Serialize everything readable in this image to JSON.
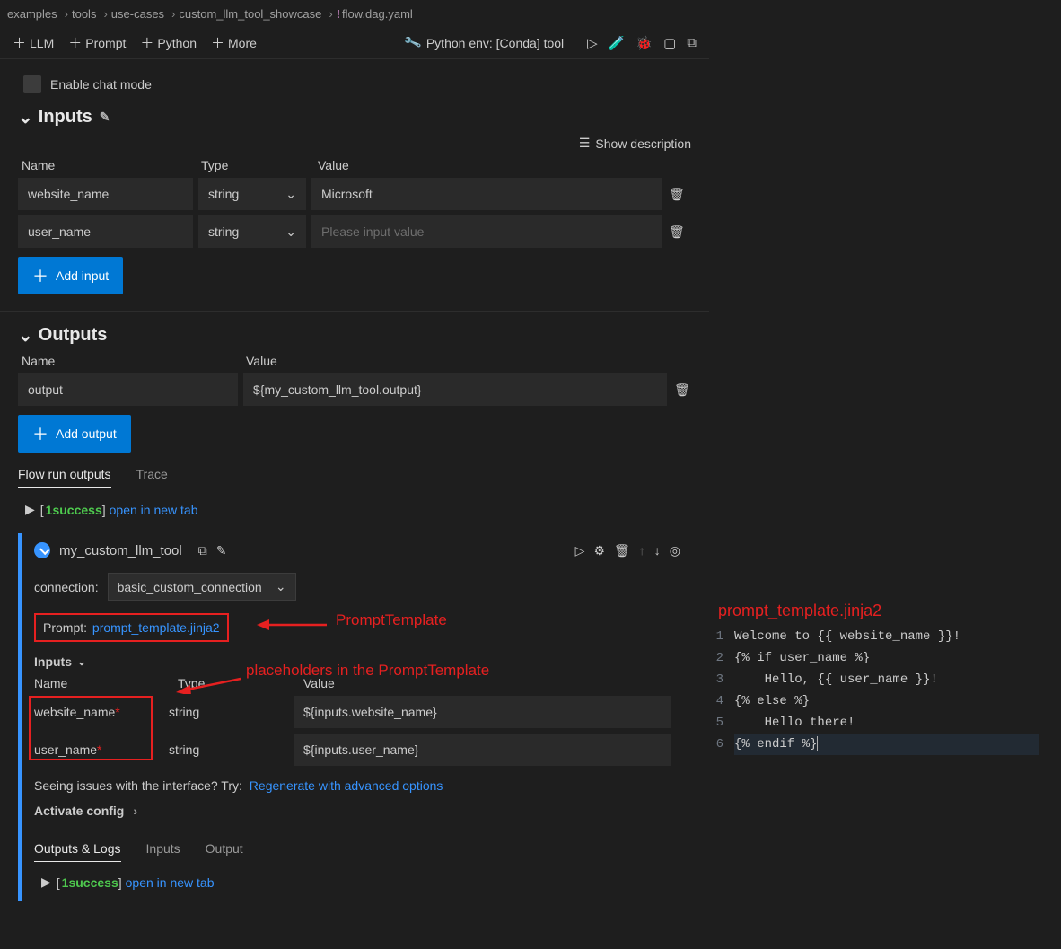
{
  "breadcrumb": {
    "items": [
      "examples",
      "tools",
      "use-cases",
      "custom_llm_tool_showcase"
    ],
    "file": "flow.dag.yaml",
    "file_bang": "!"
  },
  "toolbar": {
    "llm": "LLM",
    "prompt": "Prompt",
    "python": "Python",
    "more": "More",
    "env": "Python env: [Conda] tool"
  },
  "chat": {
    "label": "Enable chat mode"
  },
  "inputs": {
    "title": "Inputs",
    "show_desc": "Show description",
    "headers": {
      "name": "Name",
      "type": "Type",
      "value": "Value"
    },
    "rows": [
      {
        "name": "website_name",
        "type": "string",
        "value": "Microsoft"
      },
      {
        "name": "user_name",
        "type": "string",
        "value": "",
        "placeholder": "Please input value"
      }
    ],
    "add_label": "Add input"
  },
  "outputs": {
    "title": "Outputs",
    "headers": {
      "name": "Name",
      "value": "Value"
    },
    "row": {
      "name": "output",
      "value": "${my_custom_llm_tool.output}"
    },
    "add_label": "Add output",
    "tabs": {
      "flow_run": "Flow run outputs",
      "trace": "Trace"
    },
    "run": {
      "count": "1",
      "status": "success",
      "open": "open in new tab"
    }
  },
  "node": {
    "title": "my_custom_llm_tool",
    "connection_label": "connection:",
    "connection_value": "basic_custom_connection",
    "prompt_label": "Prompt:",
    "prompt_file": "prompt_template.jinja2",
    "inputs_label": "Inputs",
    "headers": {
      "name": "Name",
      "type": "Type",
      "value": "Value"
    },
    "rows": [
      {
        "name": "website_name",
        "type": "string",
        "value": "${inputs.website_name}"
      },
      {
        "name": "user_name",
        "type": "string",
        "value": "${inputs.user_name}"
      }
    ],
    "issue_pre": "Seeing issues with the interface? Try: ",
    "issue_link": "Regenerate with advanced options",
    "activate": "Activate config",
    "tabs": {
      "outputs_logs": "Outputs & Logs",
      "inputs": "Inputs",
      "output": "Output"
    },
    "run": {
      "count": "1",
      "status": "success",
      "open": "open in new tab"
    }
  },
  "annotations": {
    "prompt_template": "PromptTemplate",
    "placeholders": "placeholders in the PromptTemplate"
  },
  "editor": {
    "title": "prompt_template.jinja2",
    "lines": [
      "Welcome to {{ website_name }}!",
      "{% if user_name %}",
      "    Hello, {{ user_name }}!",
      "{% else %}",
      "    Hello there!",
      "{% endif %}"
    ]
  }
}
